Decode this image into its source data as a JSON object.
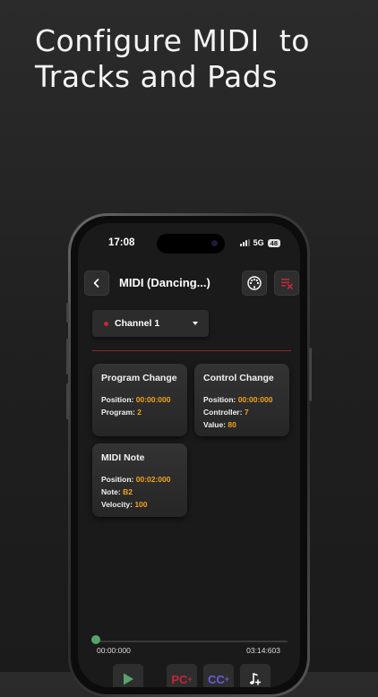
{
  "headline": {
    "line1": "Configure MIDI  to",
    "line2": "Tracks and Pads"
  },
  "status": {
    "time": "17:08",
    "network": "5G",
    "battery": "48"
  },
  "appbar": {
    "title": "MIDI (Dancing...)"
  },
  "channel": {
    "selected": "Channel 1"
  },
  "cards": [
    {
      "title": "Program Change",
      "rows": [
        {
          "label": "Position: ",
          "value": "00:00:000"
        },
        {
          "label": "Program: ",
          "value": "2"
        }
      ]
    },
    {
      "title": "Control Change",
      "rows": [
        {
          "label": "Position: ",
          "value": "00:00:000"
        },
        {
          "label": "Controller: ",
          "value": "7"
        },
        {
          "label": "Value: ",
          "value": "80"
        }
      ]
    },
    {
      "title": "MIDI Note",
      "rows": [
        {
          "label": "Position: ",
          "value": "00:02:000"
        },
        {
          "label": "Note: ",
          "value": "B2"
        },
        {
          "label": "Velocity: ",
          "value": "100"
        }
      ]
    }
  ],
  "playback": {
    "current": "00:00:000",
    "total": "03:14:603",
    "progress": 0
  },
  "toolbar": {
    "pc_label": "PC",
    "cc_label": "CC"
  },
  "colors": {
    "accent_red": "#c0283a",
    "value_orange": "#f2a31b",
    "progress_green": "#58a36a",
    "cc_purple": "#6b5cd6"
  },
  "icons": [
    "back-icon",
    "midi-connector-icon",
    "clear-list-icon",
    "play-icon",
    "add-note-icon"
  ]
}
